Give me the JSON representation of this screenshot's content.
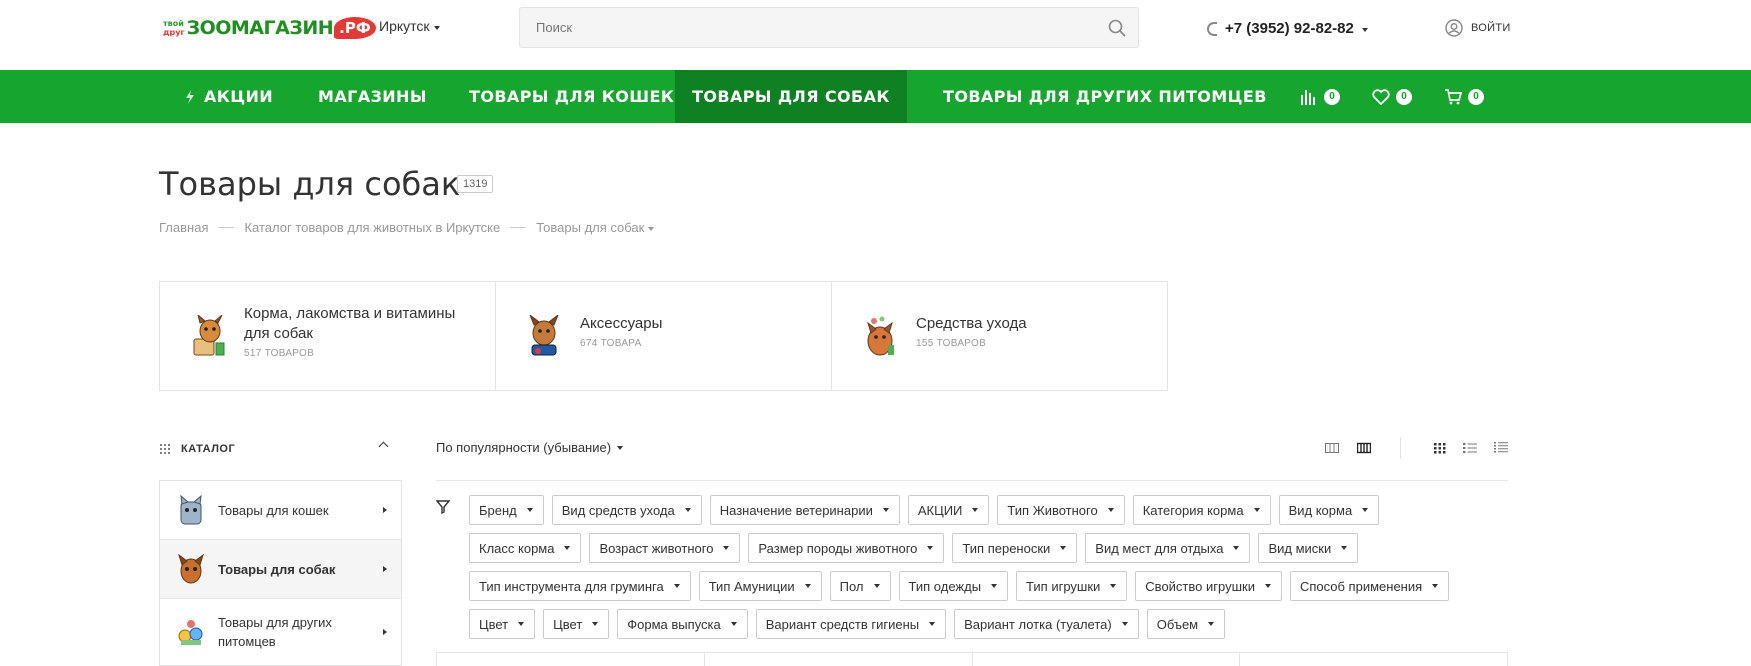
{
  "header": {
    "logo_small_1": "твой",
    "logo_small_2": "друг",
    "logo_main": "ЗООМАГАЗИН",
    "logo_rf": ".РФ",
    "city": "Иркутск",
    "search_placeholder": "Поиск",
    "phone": "+7 (3952) 92-82-82",
    "login": "ВОЙТИ"
  },
  "nav": {
    "items": [
      {
        "label": "АКЦИИ"
      },
      {
        "label": "МАГАЗИНЫ"
      },
      {
        "label": "ТОВАРЫ ДЛЯ КОШЕК"
      },
      {
        "label": "ТОВАРЫ ДЛЯ СОБАК"
      },
      {
        "label": "ТОВАРЫ ДЛЯ ДРУГИХ ПИТОМЦЕВ"
      }
    ],
    "compare_count": "0",
    "favorites_count": "0",
    "cart_count": "0"
  },
  "page": {
    "title": "Товары для собак",
    "count": "1319"
  },
  "breadcrumb": [
    "Главная",
    "Каталог товаров для животных в Иркутске",
    "Товары для собак"
  ],
  "categories": [
    {
      "title": "Корма, лакомства и витамины для собак",
      "count": "517 ТОВАРОВ"
    },
    {
      "title": "Аксессуары",
      "count": "674 ТОВАРА"
    },
    {
      "title": "Средства ухода",
      "count": "155 ТОВАРОВ"
    }
  ],
  "sidebar": {
    "heading": "КАТАЛОГ",
    "items": [
      {
        "label": "Товары для кошек"
      },
      {
        "label": "Товары для собак"
      },
      {
        "label": "Товары для других питомцев"
      }
    ]
  },
  "sort": {
    "label": "По популярности (убывание)"
  },
  "filters": [
    "Бренд",
    "Вид средств ухода",
    "Назначение ветеринарии",
    "АКЦИИ",
    "Тип Животного",
    "Категория корма",
    "Вид корма",
    "Класс корма",
    "Возраст животного",
    "Размер породы животного",
    "Тип переноски",
    "Вид мест для отдыха",
    "Вид миски",
    "Тип инструмента для груминга",
    "Тип Амуниции",
    "Пол",
    "Тип одежды",
    "Тип игрушки",
    "Свойство игрушки",
    "Способ применения",
    "Цвет",
    "Цвет",
    "Форма выпуска",
    "Вариант средств гигиены",
    "Вариант лотка (туалета)",
    "Объем"
  ],
  "colors": {
    "brand_green": "#16a52e",
    "active_green": "#0e8223"
  }
}
